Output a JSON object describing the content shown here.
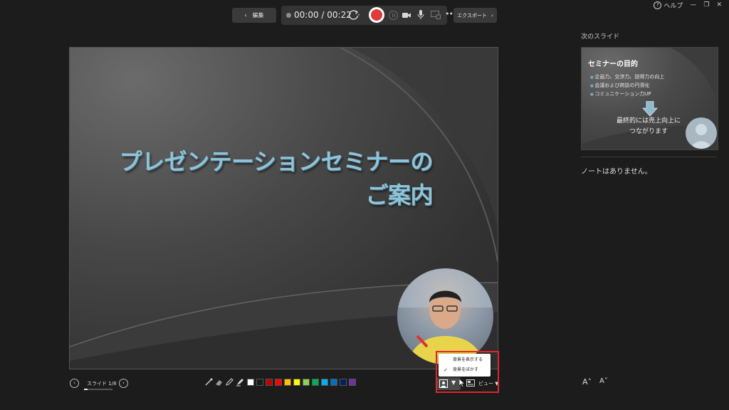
{
  "window": {
    "help_label": "ヘルプ"
  },
  "toolbar": {
    "edit_label": "編集",
    "timer": "00:00 / 00:22",
    "export_label": "エクスポート",
    "more_label": "•••"
  },
  "slide": {
    "title_line1": "プレゼンテーションセミナーの",
    "title_line2": "ご案内"
  },
  "nav": {
    "counter": "スライド 1/8",
    "progress": 0.125
  },
  "palette": {
    "colors": [
      "#ffffff",
      "#1a1a1a",
      "#c00000",
      "#ff0000",
      "#ffc000",
      "#ffff00",
      "#92d050",
      "#00b050",
      "#00b0f0",
      "#0070c0",
      "#002060",
      "#7030a0"
    ]
  },
  "camera_menu": {
    "items": [
      {
        "label": "背景を表示する",
        "checked": false
      },
      {
        "label": "背景をぼかす",
        "checked": true
      }
    ]
  },
  "view": {
    "label": "ビュー"
  },
  "right_pane": {
    "next_label": "次のスライド",
    "next_slide": {
      "title": "セミナーの目的",
      "bullets": [
        "企画力、交渉力、説得力の向上",
        "会議および商談の円滑化",
        "コミュニケーション力UP"
      ],
      "conclusion_line1": "最終的には売上向上に",
      "conclusion_line2": "つながります"
    },
    "notes": "ノートはありません。"
  },
  "font_controls": {
    "bigger": "A˄",
    "smaller": "A˅"
  }
}
